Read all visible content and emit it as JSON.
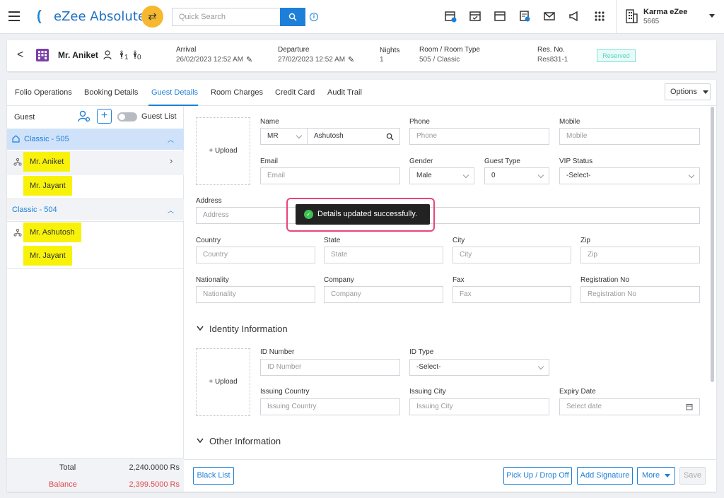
{
  "topbar": {
    "app_name": "eZee Absolute",
    "search_placeholder": "Quick Search",
    "user_name": "Karma eZee",
    "user_code": "5665"
  },
  "reservation": {
    "guest_name": "Mr. Aniket",
    "adults": "1",
    "children": "0",
    "arrival_label": "Arrival",
    "arrival_value": "26/02/2023 12:52 AM",
    "departure_label": "Departure",
    "departure_value": "27/02/2023 12:52 AM",
    "nights_label": "Nights",
    "nights_value": "1",
    "room_label": "Room / Room Type",
    "room_value": "505 / Classic",
    "resno_label": "Res. No.",
    "resno_value": "Res831-1",
    "status": "Reserved"
  },
  "tabs": [
    "Folio Operations",
    "Booking Details",
    "Guest Details",
    "Room Charges",
    "Credit Card",
    "Audit Trail"
  ],
  "options_label": "Options",
  "guest_panel": {
    "title": "Guest",
    "toggle_label": "Guest List",
    "groups": [
      {
        "label": "Classic - 505",
        "guests": [
          "Mr. Aniket",
          "Mr. Jayant"
        ]
      },
      {
        "label": "Classic - 504",
        "guests": [
          "Mr. Ashutosh",
          "Mr. Jayant"
        ]
      }
    ],
    "total_label": "Total",
    "total_value": "2,240.0000 Rs",
    "balance_label": "Balance",
    "balance_value": "2,399.5000 Rs"
  },
  "form": {
    "upload_label": "+ Upload",
    "name_label": "Name",
    "salutation": "MR",
    "name_value": "Ashutosh",
    "phone_label": "Phone",
    "phone_placeholder": "Phone",
    "mobile_label": "Mobile",
    "mobile_placeholder": "Mobile",
    "email_label": "Email",
    "email_placeholder": "Email",
    "gender_label": "Gender",
    "gender_value": "Male",
    "guest_type_label": "Guest Type",
    "guest_type_value": "0",
    "vip_label": "VIP Status",
    "vip_value": "-Select-",
    "address_label": "Address",
    "address_placeholder": "Address",
    "country_label": "Country",
    "country_placeholder": "Country",
    "state_label": "State",
    "state_placeholder": "State",
    "city_label": "City",
    "city_placeholder": "City",
    "zip_label": "Zip",
    "zip_placeholder": "Zip",
    "nationality_label": "Nationality",
    "nationality_placeholder": "Nationality",
    "company_label": "Company",
    "company_placeholder": "Company",
    "fax_label": "Fax",
    "fax_placeholder": "Fax",
    "regno_label": "Registration No",
    "regno_placeholder": "Registration No",
    "identity_title": "Identity Information",
    "idnum_label": "ID Number",
    "idnum_placeholder": "ID Number",
    "idtype_label": "ID Type",
    "idtype_value": "-Select-",
    "icountry_label": "Issuing Country",
    "icountry_placeholder": "Issuing Country",
    "icity_label": "Issuing City",
    "icity_placeholder": "Issuing City",
    "expiry_label": "Expiry Date",
    "expiry_placeholder": "Select date",
    "other_title": "Other Information"
  },
  "footer": {
    "blacklist": "Black List",
    "pickup": "Pick Up / Drop Off",
    "signature": "Add Signature",
    "more": "More",
    "save": "Save"
  },
  "toast": "Details updated successfully."
}
